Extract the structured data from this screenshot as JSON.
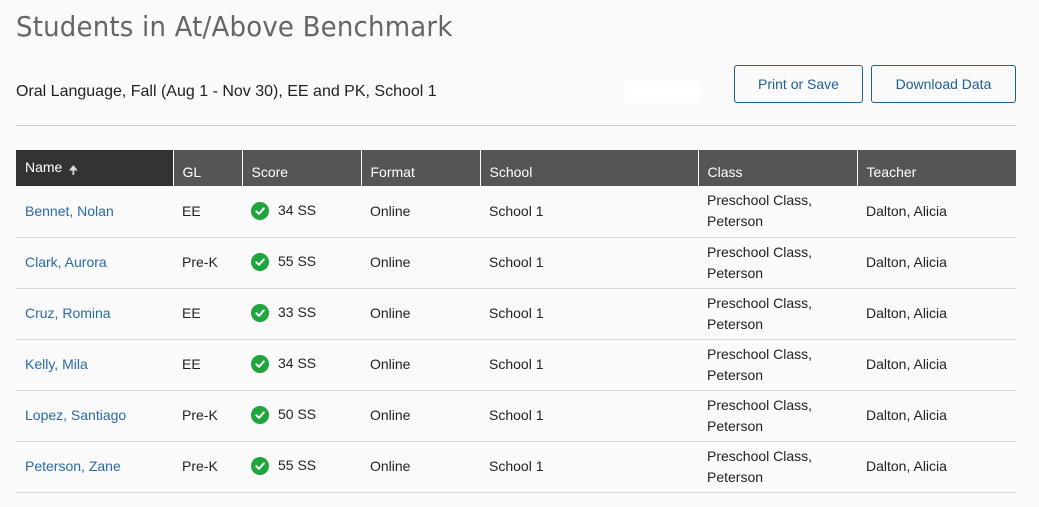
{
  "page": {
    "title": "Students in At/Above Benchmark",
    "subtitle": "Oral Language, Fall (Aug 1 - Nov 30), EE and PK, School 1"
  },
  "actions": {
    "print_label": "Print or Save",
    "download_label": "Download Data"
  },
  "table": {
    "columns": [
      "Name",
      "GL",
      "Score",
      "Format",
      "School",
      "Class",
      "Teacher"
    ],
    "sort": {
      "column": "Name",
      "direction": "ascending",
      "icon": "arrow-up-icon"
    },
    "rows": [
      {
        "name": "Bennet, Nolan",
        "gl": "EE",
        "score": "34 SS",
        "status_icon": "check-circle-icon",
        "format": "Online",
        "school": "School 1",
        "class": "Preschool Class, Peterson",
        "teacher": "Dalton, Alicia"
      },
      {
        "name": "Clark, Aurora",
        "gl": "Pre-K",
        "score": "55 SS",
        "status_icon": "check-circle-icon",
        "format": "Online",
        "school": "School 1",
        "class": "Preschool Class, Peterson",
        "teacher": "Dalton, Alicia"
      },
      {
        "name": "Cruz, Romina",
        "gl": "EE",
        "score": "33 SS",
        "status_icon": "check-circle-icon",
        "format": "Online",
        "school": "School 1",
        "class": "Preschool Class, Peterson",
        "teacher": "Dalton, Alicia"
      },
      {
        "name": "Kelly, Mila",
        "gl": "EE",
        "score": "34 SS",
        "status_icon": "check-circle-icon",
        "format": "Online",
        "school": "School 1",
        "class": "Preschool Class, Peterson",
        "teacher": "Dalton, Alicia"
      },
      {
        "name": "Lopez, Santiago",
        "gl": "Pre-K",
        "score": "50 SS",
        "status_icon": "check-circle-icon",
        "format": "Online",
        "school": "School 1",
        "class": "Preschool Class, Peterson",
        "teacher": "Dalton, Alicia"
      },
      {
        "name": "Peterson, Zane",
        "gl": "Pre-K",
        "score": "55 SS",
        "status_icon": "check-circle-icon",
        "format": "Online",
        "school": "School 1",
        "class": "Preschool Class, Peterson",
        "teacher": "Dalton, Alicia"
      }
    ]
  },
  "colors": {
    "header_bg": "#555555",
    "sorted_header_bg": "#333333",
    "link": "#2a6aa8",
    "button_border": "#1f5f96",
    "check": "#1fa53d"
  }
}
